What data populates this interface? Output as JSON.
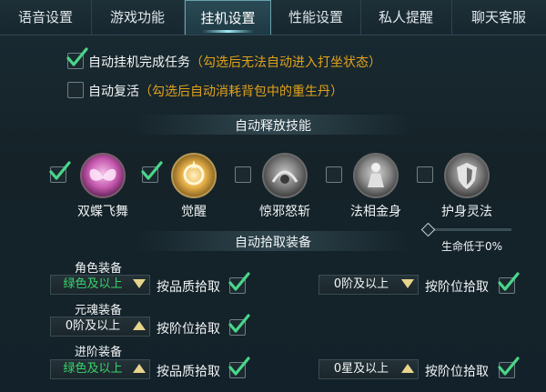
{
  "tabs": [
    {
      "label": "语音设置"
    },
    {
      "label": "游戏功能"
    },
    {
      "label": "挂机设置",
      "active": true
    },
    {
      "label": "性能设置"
    },
    {
      "label": "私人提醒"
    },
    {
      "label": "聊天客服"
    }
  ],
  "options": {
    "auto_task": {
      "label": "自动挂机完成任务",
      "hint": "（勾选后无法自动进入打坐状态）",
      "checked": true
    },
    "auto_revive": {
      "label": "自动复活",
      "hint": "（勾选后自动消耗背包中的重生丹）",
      "checked": false
    }
  },
  "skills_section": {
    "title": "自动释放技能",
    "skills": [
      {
        "name": "双蝶飞舞",
        "icon": "butterfly-skill-icon",
        "checked": true
      },
      {
        "name": "觉醒",
        "icon": "awaken-skill-icon",
        "checked": true
      },
      {
        "name": "惊邪怒斩",
        "icon": "slash-skill-icon",
        "checked": false
      },
      {
        "name": "法相金身",
        "icon": "golden-body-skill-icon",
        "checked": false
      },
      {
        "name": "护身灵法",
        "icon": "shield-spell-skill-icon",
        "checked": false
      }
    ]
  },
  "hp_slider": {
    "label": "生命低于0%",
    "value_percent": 0
  },
  "pickup_section": {
    "title": "自动拾取装备",
    "role_equip": {
      "label": "角色装备",
      "quality_value": "绿色及以上",
      "quality_pick_label": "按品质拾取",
      "quality_checked": true,
      "tier_value": "0阶及以上",
      "tier_pick_label": "按阶位拾取",
      "tier_checked": true
    },
    "soul_equip": {
      "label": "元魂装备",
      "tier_value": "0阶及以上",
      "tier_pick_label": "按阶位拾取",
      "tier_checked": true
    },
    "advance_equip": {
      "label": "进阶装备",
      "quality_value": "绿色及以上",
      "quality_pick_label": "按品质拾取",
      "quality_checked": true,
      "star_value": "0星及以上",
      "star_pick_label": "按阶位拾取",
      "star_checked": true
    }
  },
  "colors": {
    "check": "#49d68a",
    "hint": "#e0a21b",
    "green_value": "#39d36b",
    "arrow": "#e7d58b"
  }
}
